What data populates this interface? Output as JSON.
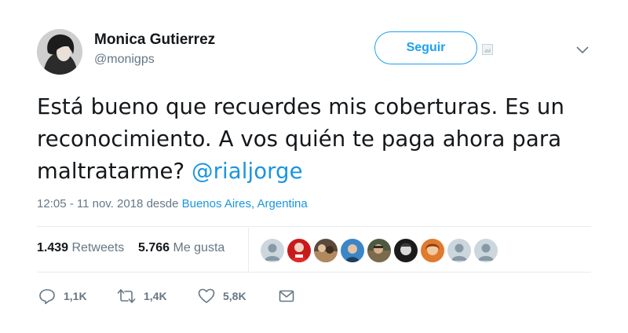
{
  "author": {
    "name": "Monica Gutierrez",
    "handle": "@monigps",
    "avatar_icon": "profile-photo"
  },
  "follow_button": {
    "label": "Seguir"
  },
  "tweet": {
    "text": "Está bueno que recuerdes mis coberturas. Es un reconocimiento. A vos quién te paga ahora para maltratarme?",
    "mention": "@rialjorge"
  },
  "meta": {
    "timestamp": "12:05 - 11 nov. 2018",
    "from_label": "desde",
    "location": "Buenos Aires, Argentina"
  },
  "stats": {
    "retweets_count": "1.439",
    "retweets_label": "Retweets",
    "likes_count": "5.766",
    "likes_label": "Me gusta"
  },
  "likers": [
    {
      "icon": "default-avatar-icon"
    },
    {
      "icon": "user-avatar-icon"
    },
    {
      "icon": "user-avatar-icon"
    },
    {
      "icon": "user-avatar-icon"
    },
    {
      "icon": "user-avatar-icon"
    },
    {
      "icon": "user-avatar-icon"
    },
    {
      "icon": "user-avatar-icon"
    },
    {
      "icon": "default-avatar-icon"
    },
    {
      "icon": "default-avatar-icon"
    }
  ],
  "actions": {
    "reply_count": "1,1K",
    "retweet_count": "1,4K",
    "like_count": "5,8K"
  },
  "colors": {
    "accent": "#1da1f2",
    "link": "#1b95e0",
    "muted": "#657786",
    "divider": "#e6ecf0"
  }
}
